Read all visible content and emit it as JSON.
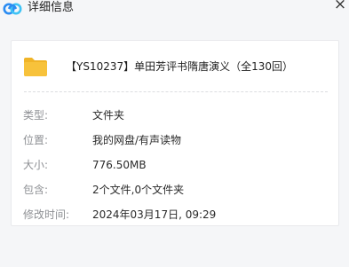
{
  "window": {
    "title": "详细信息",
    "close_glyph": "×",
    "logo_icon": "baidu-netdisk-cloud-icon"
  },
  "file": {
    "icon": "folder-icon",
    "name": "【YS10237】单田芳评书隋唐演义（全130回）"
  },
  "details": [
    {
      "label": "类型:",
      "value": "文件夹"
    },
    {
      "label": "位置:",
      "value": "我的网盘/有声读物"
    },
    {
      "label": "大小:",
      "value": "776.50MB"
    },
    {
      "label": "包含:",
      "value": "2个文件,0个文件夹"
    },
    {
      "label": "修改时间:",
      "value": "2024年03月17日, 09:29"
    }
  ],
  "colors": {
    "background": "#f5f6f8",
    "card": "#ffffff",
    "folder": "#f7c23b",
    "logo_blue": "#2b8cf2",
    "logo_cyan": "#3ec3f5"
  }
}
